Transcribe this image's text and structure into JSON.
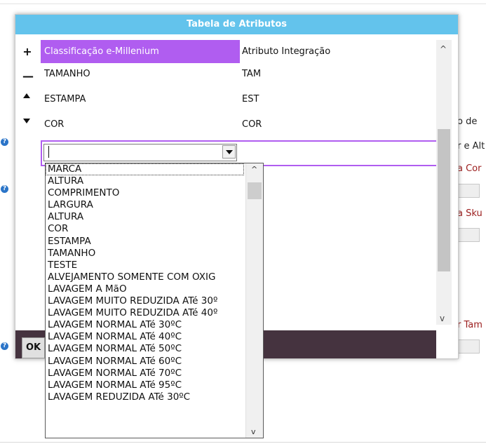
{
  "dialog": {
    "title": "Tabela de Atributos",
    "buttons": {
      "add": "+",
      "remove": "—"
    },
    "columns": [
      "Classificação e-Millenium",
      "Atributo Integração"
    ],
    "rows": [
      {
        "classificacao": "TAMANHO",
        "atributo": "TAM"
      },
      {
        "classificacao": "ESTAMPA",
        "atributo": "EST"
      },
      {
        "classificacao": "COR",
        "atributo": "COR"
      }
    ],
    "ok_label": "OK"
  },
  "dropdown": {
    "value": "",
    "options": [
      "MARCA",
      "ALTURA",
      "COMPRIMENTO",
      "LARGURA",
      "ALTURA",
      "COR",
      "ESTAMPA",
      "TAMANHO",
      "TESTE",
      "ALVEJAMENTO SOMENTE COM OXIG",
      "LAVAGEM A MãO",
      "LAVAGEM MUITO REDUZIDA ATé 30º",
      "LAVAGEM MUITO REDUZIDA ATé 40º",
      "LAVAGEM NORMAL ATé 30ºC",
      "LAVAGEM NORMAL ATé 40ºC",
      "LAVAGEM NORMAL ATé 50ºC",
      "LAVAGEM NORMAL ATé 60ºC",
      "LAVAGEM NORMAL ATé 70ºC",
      "LAVAGEM NORMAL ATé 95ºC",
      "LAVAGEM REDUZIDA ATé 30ºC"
    ]
  },
  "background": {
    "help_icon": "?",
    "labels": [
      "o de",
      "r e Alt",
      "a Cor",
      "a Sku",
      "r Tam"
    ],
    "ok_label": "OK"
  },
  "colors": {
    "title_bar": "#63c3ec",
    "accent": "#b05df0",
    "footer": "#45333f"
  }
}
